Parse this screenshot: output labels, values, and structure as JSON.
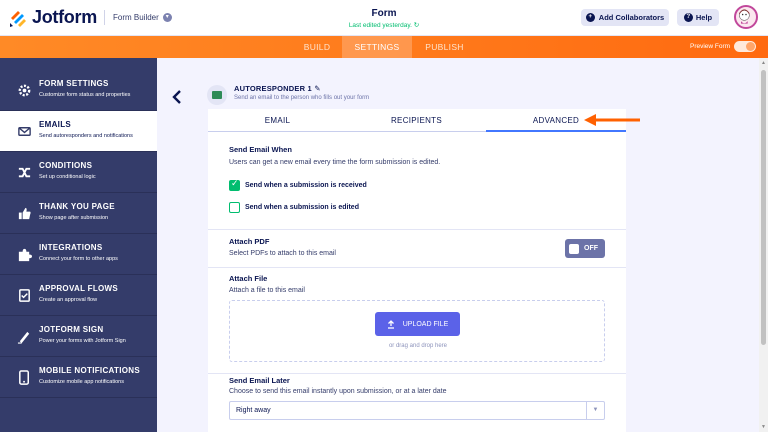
{
  "header": {
    "brand": "Jotform",
    "builder_label": "Form Builder",
    "form_title": "Form",
    "form_subtitle": "Last edited yesterday. ↻",
    "add_collaborators": "Add Collaborators",
    "help": "Help"
  },
  "nav": {
    "tabs": [
      {
        "label": "BUILD"
      },
      {
        "label": "SETTINGS"
      },
      {
        "label": "PUBLISH"
      }
    ],
    "preview_label": "Preview Form"
  },
  "sidebar": {
    "items": [
      {
        "title": "FORM SETTINGS",
        "desc": "Customize form status and properties",
        "icon": "gear-icon"
      },
      {
        "title": "EMAILS",
        "desc": "Send autoresponders and notifications",
        "icon": "envelope-icon"
      },
      {
        "title": "CONDITIONS",
        "desc": "Set up conditional logic",
        "icon": "shuffle-icon"
      },
      {
        "title": "THANK YOU PAGE",
        "desc": "Show page after submission",
        "icon": "thumbs-up-icon"
      },
      {
        "title": "INTEGRATIONS",
        "desc": "Connect your form to other apps",
        "icon": "puzzle-icon"
      },
      {
        "title": "APPROVAL FLOWS",
        "desc": "Create an approval flow",
        "icon": "approval-icon"
      },
      {
        "title": "JOTFORM SIGN",
        "desc": "Power your forms with Jotform Sign",
        "icon": "pen-icon"
      },
      {
        "title": "MOBILE NOTIFICATIONS",
        "desc": "Customize mobile app notifications",
        "icon": "mobile-icon"
      }
    ],
    "active_index": 1
  },
  "panel": {
    "name": "AUTORESPONDER 1",
    "desc": "Send an email to the person who fills out your form",
    "tabs": [
      {
        "label": "EMAIL"
      },
      {
        "label": "RECIPIENTS"
      },
      {
        "label": "ADVANCED"
      }
    ],
    "active_tab": 2
  },
  "send_when": {
    "title": "Send Email When",
    "desc": "Users can get a new email every time the form submission is edited.",
    "option1": "Send when a submission is received",
    "option1_checked": true,
    "option2": "Send when a submission is edited",
    "option2_checked": false
  },
  "attach_pdf": {
    "title": "Attach PDF",
    "desc": "Select PDFs to attach to this email",
    "toggle": "OFF"
  },
  "attach_file": {
    "title": "Attach File",
    "desc": "Attach a file to this email",
    "upload_label": "UPLOAD FILE",
    "hint": "or drag and drop here"
  },
  "send_later": {
    "title": "Send Email Later",
    "desc": "Choose to send this email instantly upon submission, or at a later date",
    "selected": "Right away"
  },
  "colors": {
    "accent": "#ff7a1a",
    "sidebar": "#343c6a",
    "success": "#01bd6f",
    "button": "#5b62e8",
    "tab_underline": "#4277ff"
  }
}
